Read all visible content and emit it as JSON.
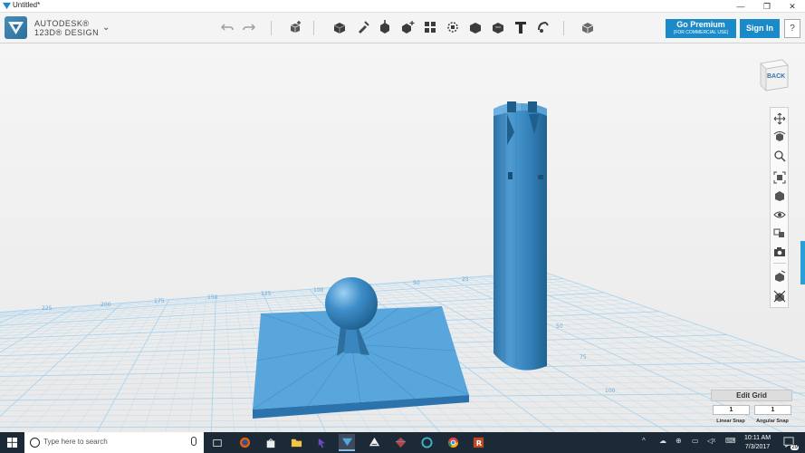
{
  "window": {
    "title": "Untitled*",
    "controls": [
      "—",
      "❐",
      "✕"
    ]
  },
  "brand": {
    "line1": "AUTODESK®",
    "line2": "123D® DESIGN",
    "menu_chevron": "⌄"
  },
  "toolbar": {
    "icons": [
      "undo-icon",
      "redo-icon",
      "primitives-icon",
      "sketch-icon",
      "construct-icon",
      "modify-icon",
      "pattern-icon",
      "grouping-icon",
      "combine-icon",
      "measure-icon",
      "text-icon",
      "snap-icon",
      "material-icon"
    ],
    "premium": {
      "label": "Go Premium",
      "sublabel": "(FOR COMMERCIAL USE)"
    },
    "sign_in": "Sign In",
    "help": "?"
  },
  "viewcube": {
    "face_label": "BACK"
  },
  "navbar": {
    "icons": [
      "pan-icon",
      "orbit-icon",
      "zoom-icon",
      "fit-icon",
      "views-icon",
      "visibility-icon",
      "material-view-icon",
      "camera-icon",
      "snap-grid-icon",
      "settings-icon"
    ]
  },
  "grid_panel": {
    "edit_grid": "Edit Grid",
    "linear_snap_value": "1",
    "angular_snap_value": "1",
    "linear_snap_label": "Linear Snap",
    "angular_snap_label": "Angular Snap"
  },
  "grid_labels": {
    "x_axis": [
      "225",
      "200",
      "175",
      "150",
      "125",
      "100",
      "75",
      "50",
      "25"
    ],
    "y_axis": [
      "50",
      "75",
      "100"
    ]
  },
  "colors": {
    "accent": "#1a8ac8",
    "model": "#3e8ec9",
    "grid_line": "#a7d3ef",
    "taskbar": "#1c2a38"
  },
  "taskbar": {
    "search_placeholder": "Type here to search",
    "apps": [
      "task-view-icon",
      "firefox-icon",
      "store-icon",
      "file-explorer-icon",
      "app-cursor-icon",
      "autodesk-123d-icon",
      "inkscape-icon",
      "app-gem-icon",
      "app-circle-icon",
      "chrome-icon",
      "app-r-icon"
    ],
    "sys_icons": [
      "^",
      "☁",
      "⊕",
      "▭",
      "◁ᵡ",
      "⌨"
    ],
    "time": "10:11 AM",
    "date": "7/3/2017",
    "notification_count": "29"
  }
}
